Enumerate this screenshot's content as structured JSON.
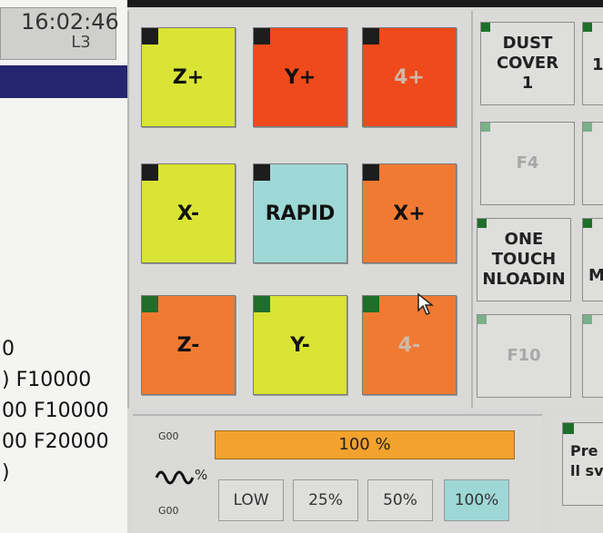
{
  "clock": {
    "time": "16:02:46",
    "line": "L3"
  },
  "gcode_lines": [
    "0",
    ") F10000",
    "00 F10000",
    "00 F20000",
    ")"
  ],
  "jog_buttons": [
    {
      "label": "Z+",
      "color": "lime"
    },
    {
      "label": "Y+",
      "color": "red"
    },
    {
      "label": "4+",
      "color": "red"
    },
    {
      "label": "X-",
      "color": "lime"
    },
    {
      "label": "RAPID",
      "color": "teal"
    },
    {
      "label": "X+",
      "color": "orange"
    },
    {
      "label": "Z-",
      "color": "orange"
    },
    {
      "label": "Y-",
      "color": "lime"
    },
    {
      "label": "4-",
      "color": "orange"
    }
  ],
  "menu": {
    "dust_cover": "DUST COVER 1",
    "f4": "F4",
    "one_touch": "ONE TOUCH NLOADIN",
    "f10": "F10",
    "side_top": "1",
    "side_mid": "M"
  },
  "override": {
    "top_label": "G00",
    "bottom_label": "G00",
    "value_text": "100 %",
    "percent_symbol": "%",
    "buttons": [
      "LOW",
      "25%",
      "50%",
      "100%"
    ],
    "active": "100%"
  },
  "pre": {
    "line1": "Pre",
    "line2": "ll sv"
  },
  "colors": {
    "lime": "#d9e434",
    "red": "#ee4a1c",
    "orange": "#f07a32",
    "teal": "#9ed8d6",
    "override_bar": "#f3a22d",
    "indicator_green": "#1f6e2a",
    "header_blue": "#252570"
  }
}
